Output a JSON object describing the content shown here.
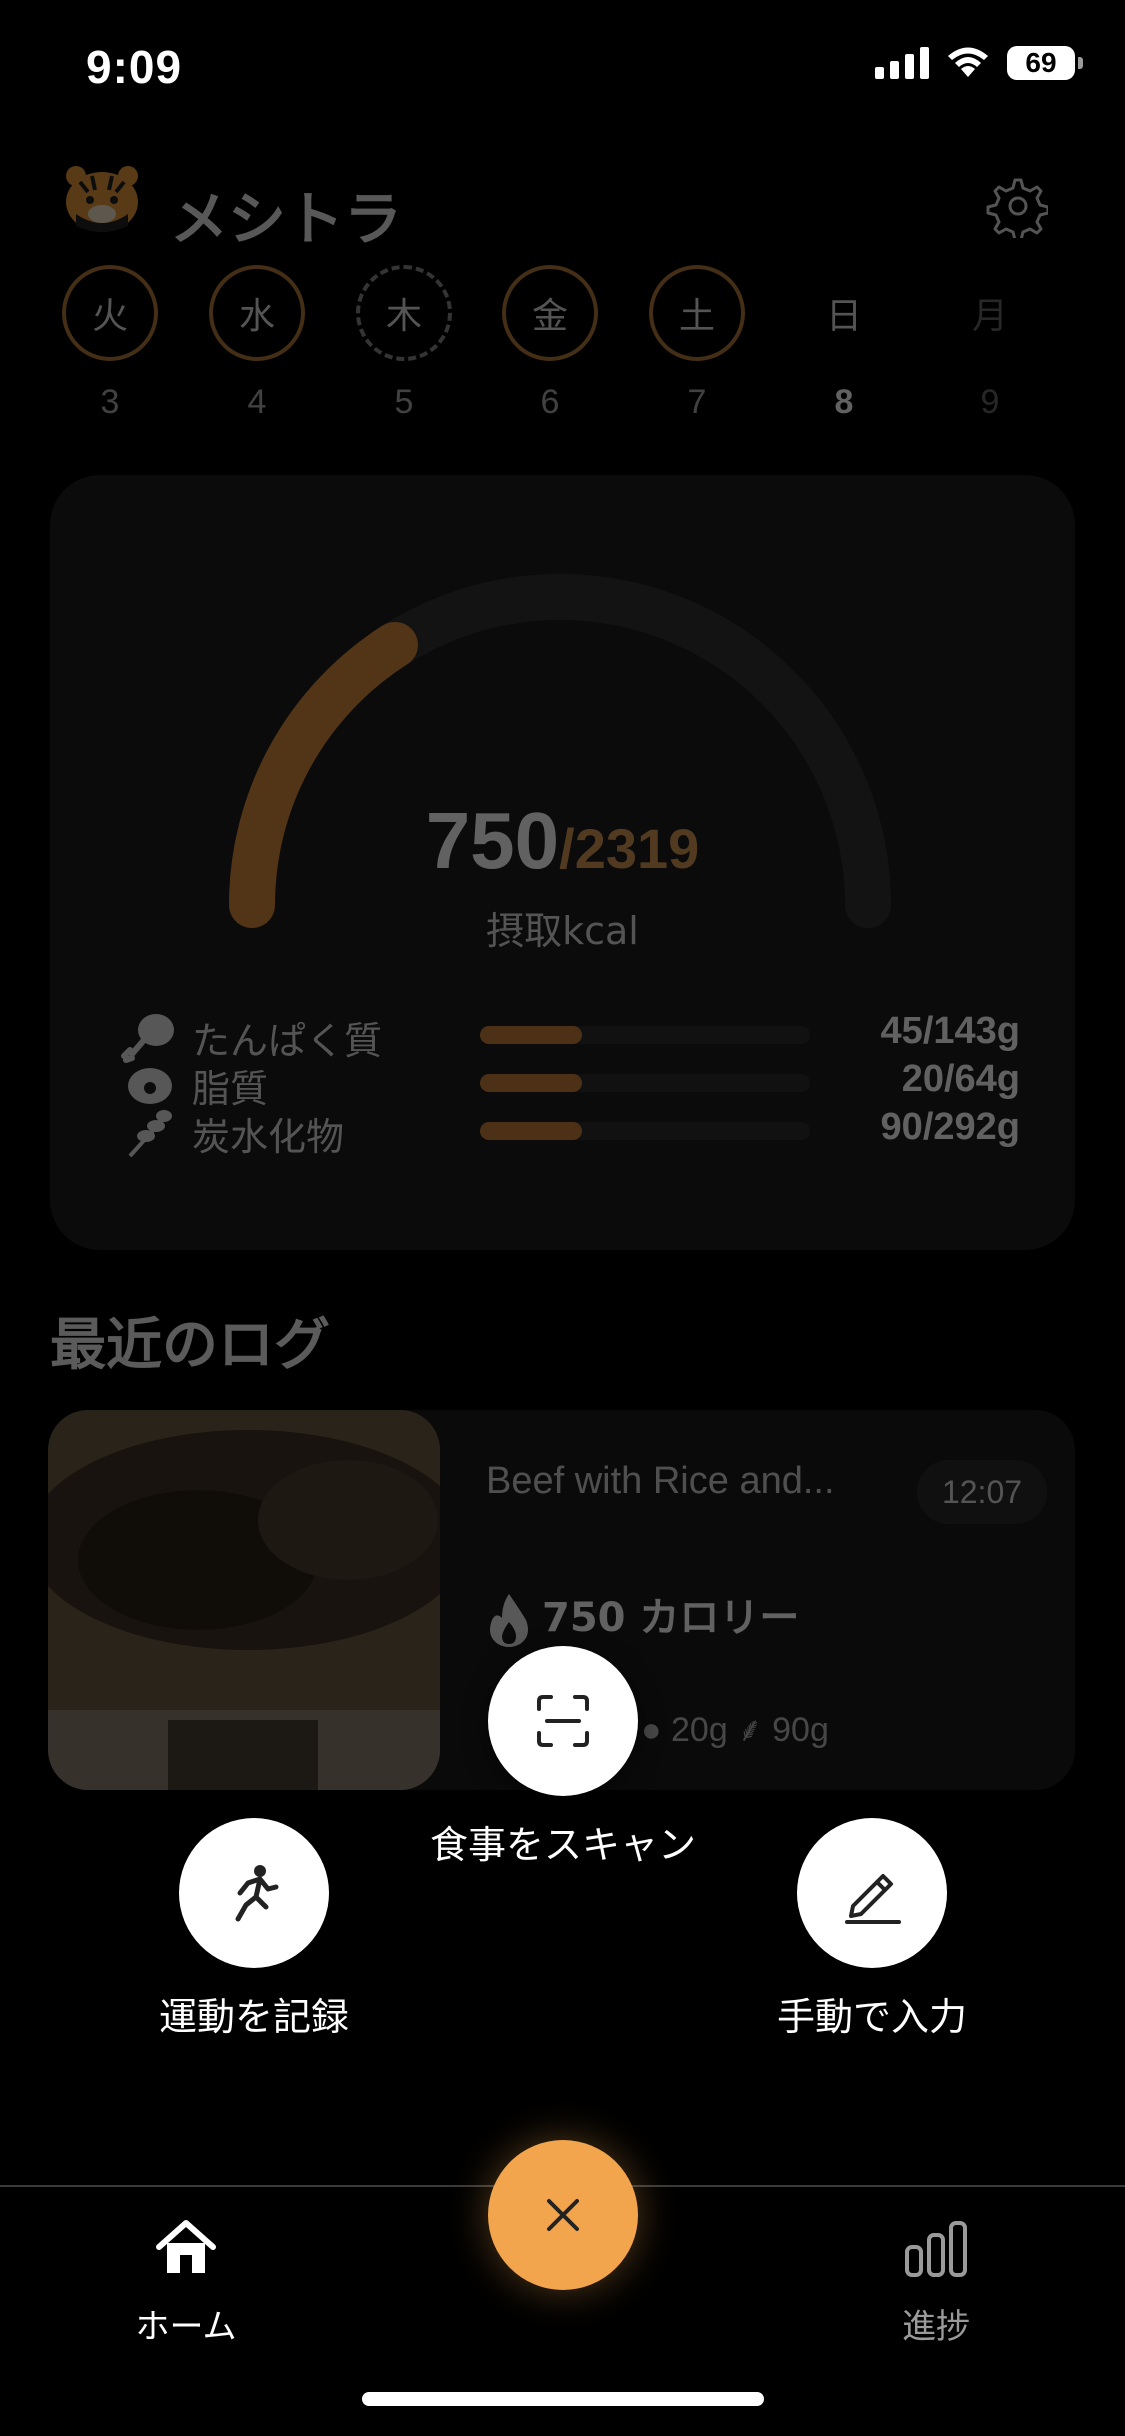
{
  "status": {
    "time": "9:09",
    "battery": "69"
  },
  "app": {
    "title": "メシトラ"
  },
  "days": [
    {
      "label": "火",
      "date": "3",
      "state": "logged"
    },
    {
      "label": "水",
      "date": "4",
      "state": "logged"
    },
    {
      "label": "木",
      "date": "5",
      "state": "missed"
    },
    {
      "label": "金",
      "date": "6",
      "state": "logged"
    },
    {
      "label": "土",
      "date": "7",
      "state": "logged"
    },
    {
      "label": "日",
      "date": "8",
      "state": "today"
    },
    {
      "label": "月",
      "date": "9",
      "state": "future"
    }
  ],
  "summary": {
    "kcal_eaten": "750",
    "kcal_total": "/2319",
    "kcal_label": "摂取kcal",
    "progress": 0.32
  },
  "macros": [
    {
      "name": "たんぱく質",
      "value": "45/143g",
      "ratio": 0.31
    },
    {
      "name": "脂質",
      "value": "20/64g",
      "ratio": 0.31
    },
    {
      "name": "炭水化物",
      "value": "90/292g",
      "ratio": 0.31
    }
  ],
  "recent": {
    "title": "最近のログ",
    "items": [
      {
        "name": "Beef with Rice and...",
        "time": "12:07",
        "kcal": "750 カロリー",
        "fat": "20g",
        "carbs": "90g"
      }
    ]
  },
  "actions": {
    "scan": "食事をスキャン",
    "exercise": "運動を記録",
    "manual": "手動で入力"
  },
  "tabs": {
    "home": "ホーム",
    "progress": "進捗"
  },
  "colors": {
    "accent": "#f2a54c",
    "accent_dark": "#c7803c",
    "background": "#000000"
  }
}
